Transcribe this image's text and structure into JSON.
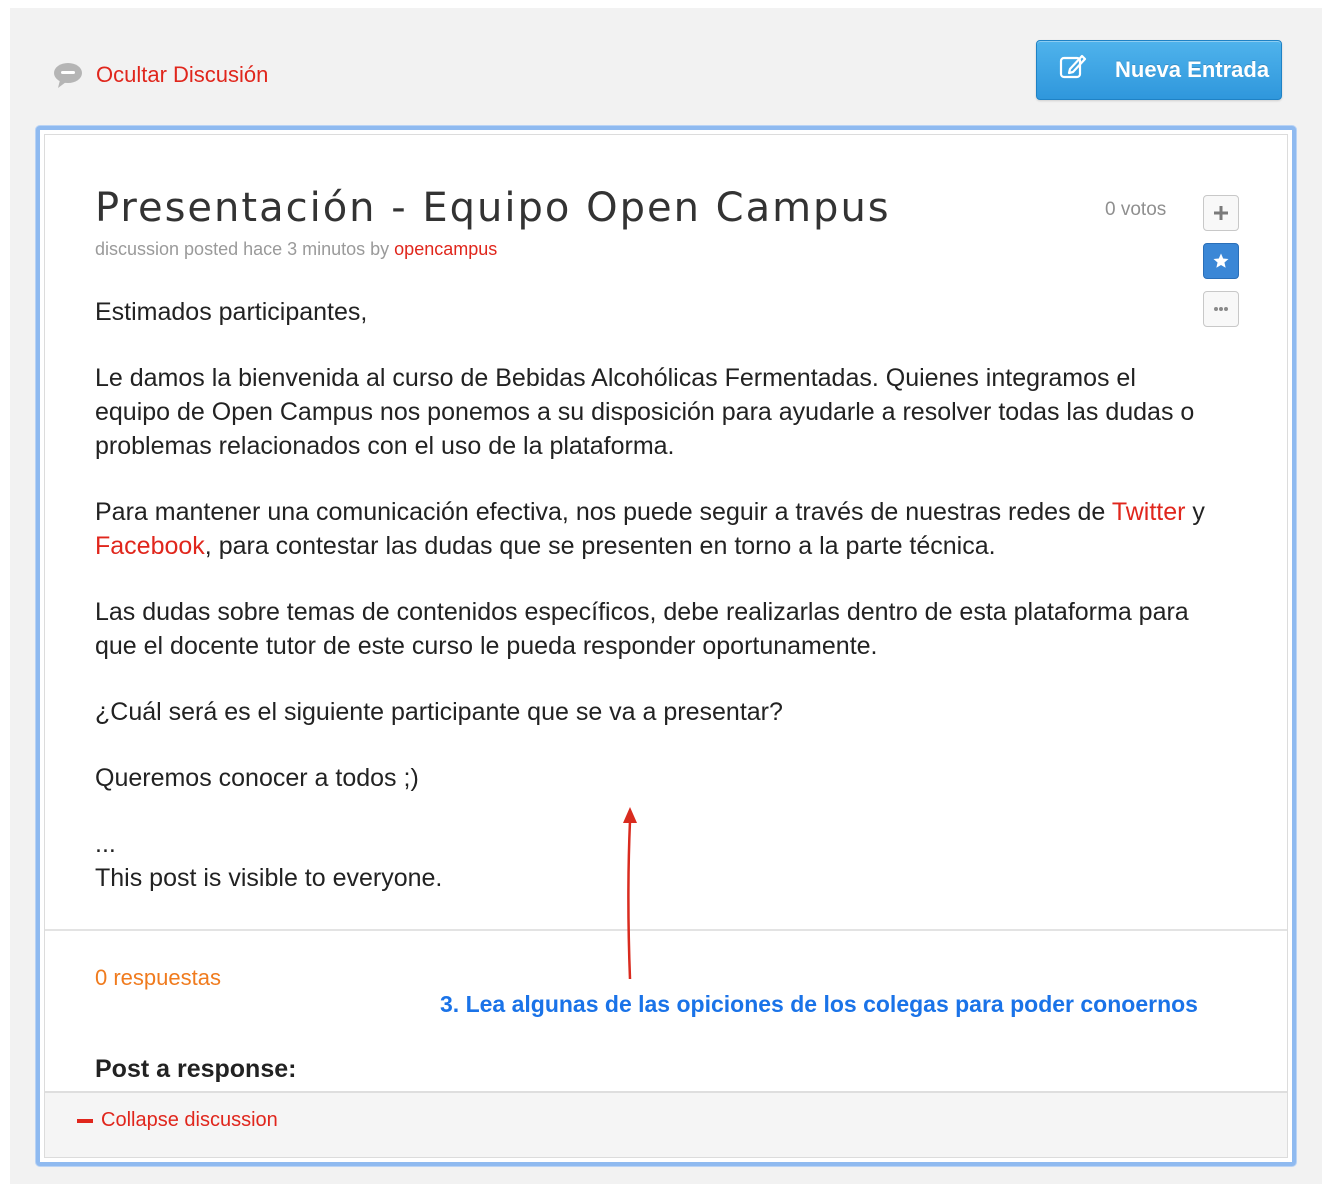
{
  "header": {
    "hide_discussion": "Ocultar Discusión",
    "new_entry": "Nueva Entrada"
  },
  "post": {
    "title": "Presentación - Equipo Open Campus",
    "meta_prefix": "discussion posted hace 3 minutos by ",
    "author": "opencampus",
    "votes": "0 votos",
    "paragraphs": [
      "Estimados participantes,",
      "Le damos la bienvenida al curso de Bebidas Alcohólicas Fermentadas. Quienes integramos el equipo de Open Campus nos ponemos a su disposición para ayudarle a resolver todas las dudas o problemas relacionados con el uso de la plataforma."
    ],
    "p3_before": "Para mantener una comunicación efectiva, nos puede seguir a través de nuestras redes de ",
    "twitter": "Twitter",
    "p3_mid": " y ",
    "facebook": "Facebook",
    "p3_after": ", para contestar las dudas que se presenten en torno a la parte técnica.",
    "p4": "Las dudas sobre temas de contenidos específicos, debe realizarlas dentro de esta plataforma para que el docente tutor de este curso le pueda responder oportunamente.",
    "p5": "¿Cuál será es el siguiente participante que se va a presentar?",
    "p6": "Queremos conocer a todos ;)",
    "ellipsis": "...",
    "visibility": "This post is visible to everyone."
  },
  "responses": {
    "count_label": "0 respuestas",
    "post_response_label": "Post a response:"
  },
  "annotation": {
    "text": "3. Lea algunas de las opiciones de los colegas para poder conoernos",
    "color": "#1a73e8",
    "arrow_color": "#d92b1f"
  },
  "footer": {
    "collapse": "Collapse discussion"
  },
  "colors": {
    "link_red": "#e0261c",
    "response_orange": "#f07b1e",
    "button_blue": "#2f97dc",
    "card_border": "#8fbaf0"
  }
}
